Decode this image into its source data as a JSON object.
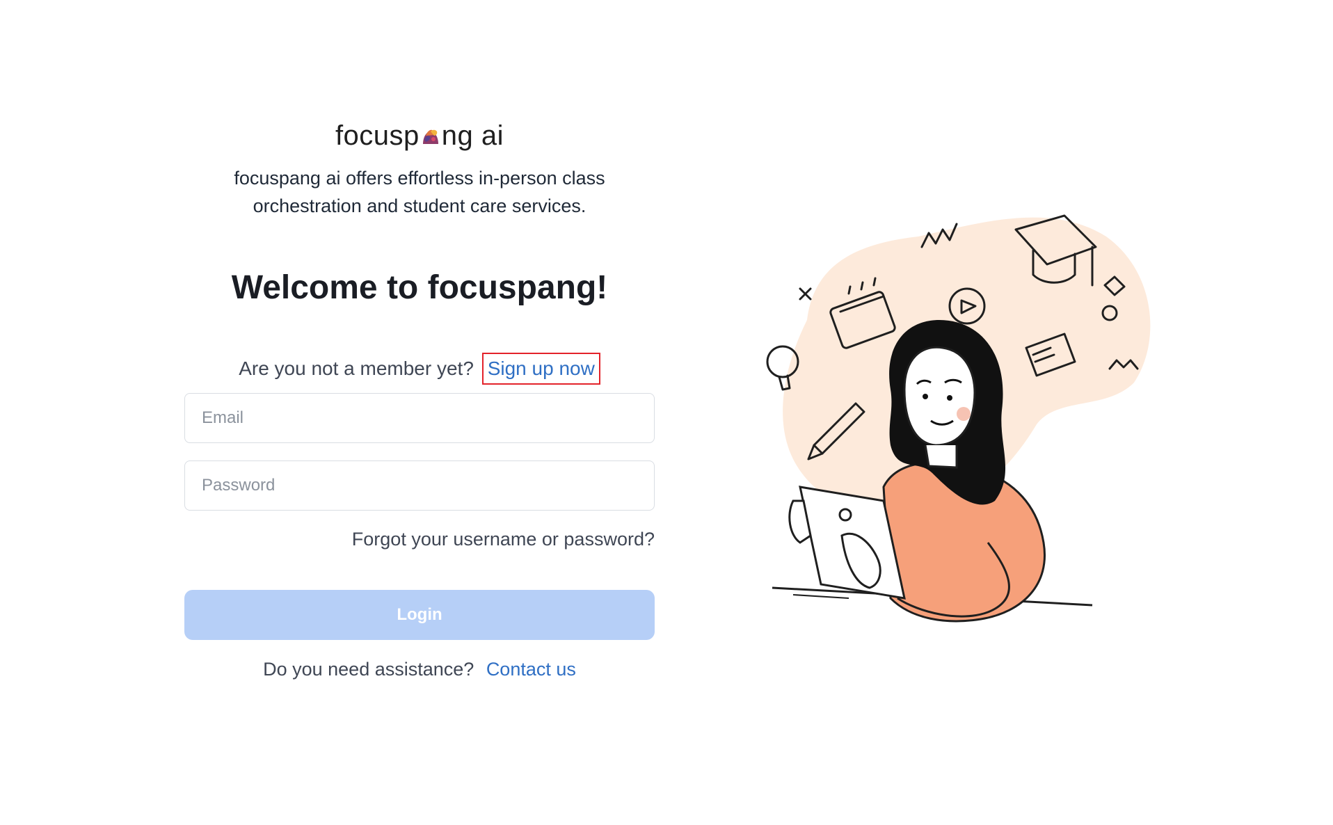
{
  "brand": {
    "name_left": "focusp",
    "name_right": "ng ai",
    "tagline": "focuspang ai offers effortless in-person class orchestration and student care services."
  },
  "welcome_title": "Welcome to focuspang!",
  "signup": {
    "prompt": "Are you not a member yet?",
    "link_label": "Sign up now"
  },
  "form": {
    "email_placeholder": "Email",
    "email_value": "",
    "password_placeholder": "Password",
    "password_value": "",
    "forgot_label": "Forgot your username or password?",
    "login_label": "Login"
  },
  "assistance": {
    "prompt": "Do you need assistance?",
    "link_label": "Contact us"
  },
  "colors": {
    "link": "#2f6fc4",
    "login_button_disabled": "#b6cff7",
    "highlight_border": "#e3222a",
    "illustration_blob": "#fdeadb",
    "shirt": "#f6a07a"
  }
}
